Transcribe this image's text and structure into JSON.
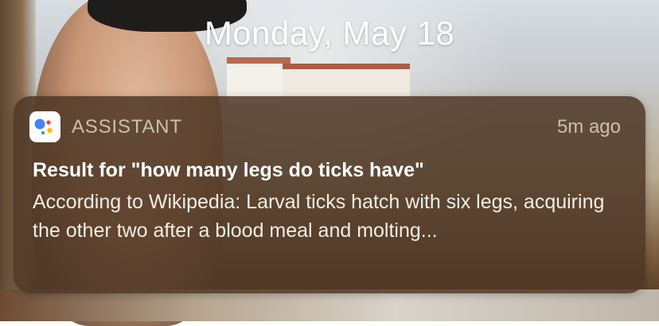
{
  "lock_screen": {
    "date": "Monday, May 18"
  },
  "notification": {
    "app_name": "ASSISTANT",
    "app_icon": "google-assistant-icon",
    "timestamp": "5m ago",
    "title": "Result for \"how many legs do ticks have\"",
    "body": "According to Wikipedia: Larval ticks hatch with six legs, acquiring the other two after a blood meal and molting..."
  },
  "colors": {
    "assistant_blue": "#4285F4",
    "assistant_red": "#EA4335",
    "assistant_yellow": "#FBBC05",
    "assistant_green": "#34A853",
    "notification_bg": "rgba(78, 56, 38, 0.86)"
  }
}
